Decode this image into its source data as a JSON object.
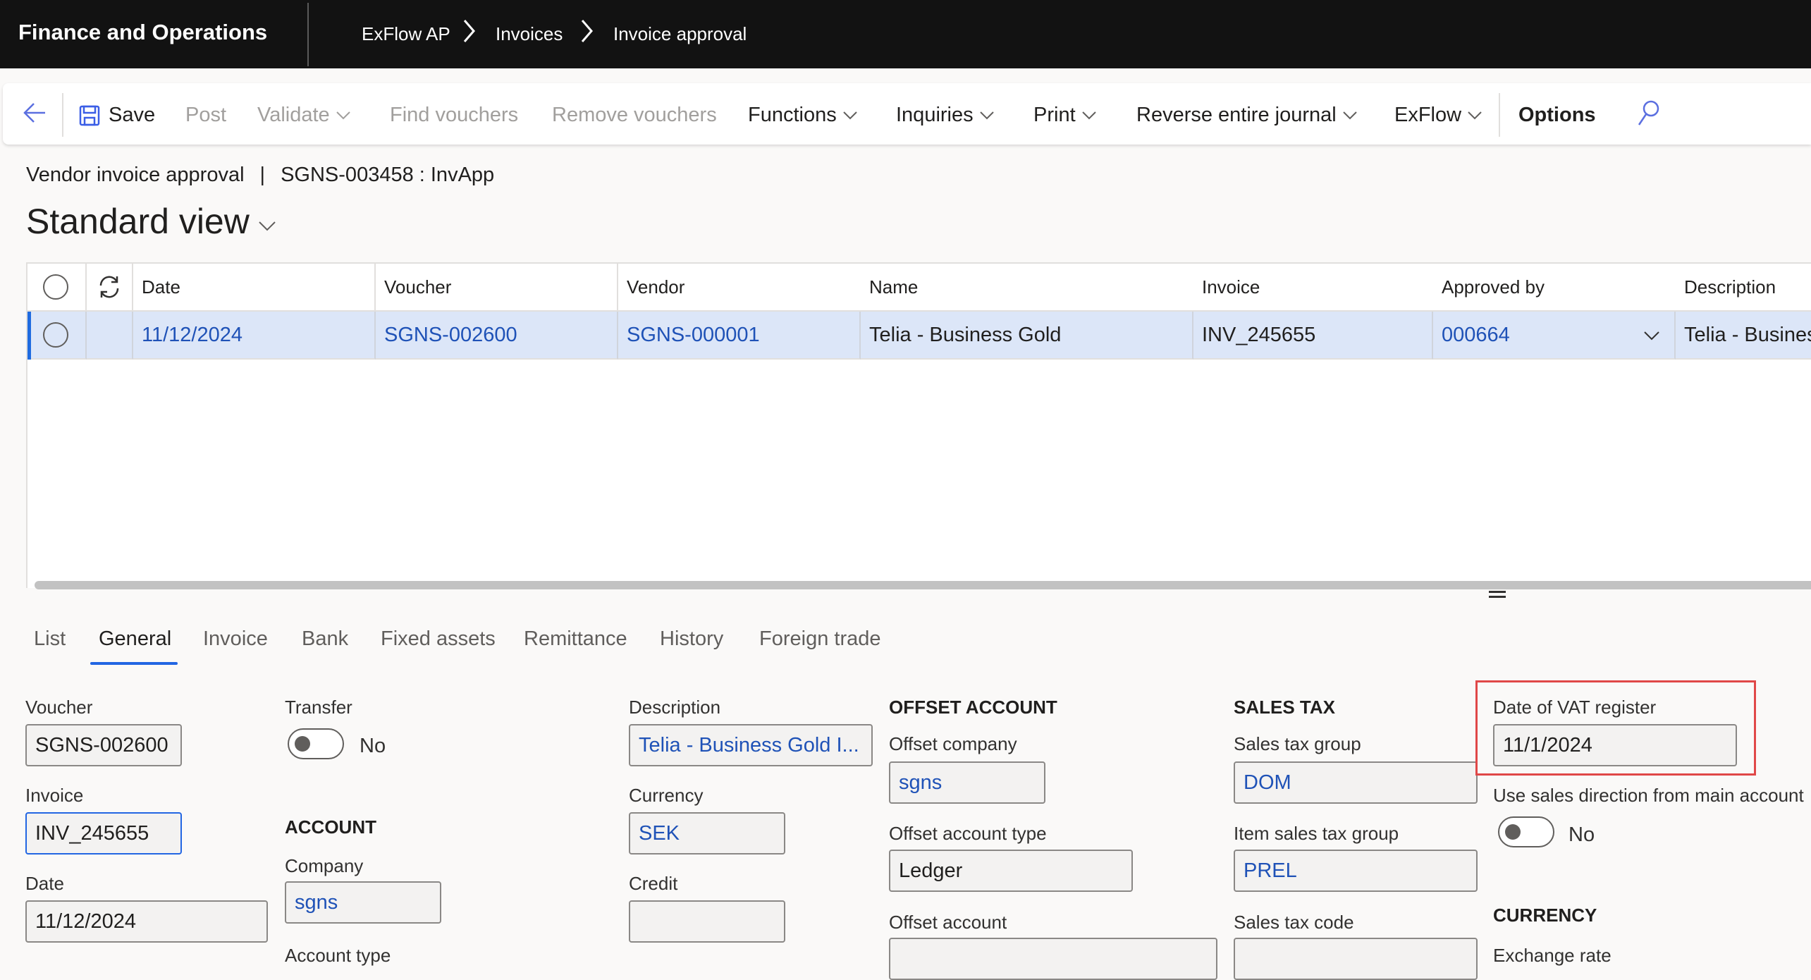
{
  "navbar": {
    "app_title": "Finance and Operations",
    "breadcrumbs": [
      "ExFlow AP",
      "Invoices",
      "Invoice approval"
    ]
  },
  "toolbar": {
    "back_icon": "back-arrow-icon",
    "items": [
      {
        "label": "Save",
        "enabled": true,
        "icon": "save-icon",
        "dropdown": false
      },
      {
        "label": "Post",
        "enabled": false,
        "dropdown": false
      },
      {
        "label": "Validate",
        "enabled": false,
        "dropdown": true
      },
      {
        "label": "Find vouchers",
        "enabled": false,
        "dropdown": false
      },
      {
        "label": "Remove vouchers",
        "enabled": false,
        "dropdown": false
      },
      {
        "label": "Functions",
        "enabled": true,
        "dropdown": true
      },
      {
        "label": "Inquiries",
        "enabled": true,
        "dropdown": true
      },
      {
        "label": "Print",
        "enabled": true,
        "dropdown": true
      },
      {
        "label": "Reverse entire journal",
        "enabled": true,
        "dropdown": true
      },
      {
        "label": "ExFlow",
        "enabled": true,
        "dropdown": true
      },
      {
        "label": "Options",
        "enabled": true,
        "dropdown": false
      }
    ],
    "search_icon": "search-icon"
  },
  "page": {
    "caption_left": "Vendor invoice approval",
    "caption_sep": "|",
    "caption_right": "SGNS-003458 : InvApp",
    "view_title": "Standard view"
  },
  "grid": {
    "columns": [
      "Date",
      "Voucher",
      "Vendor",
      "Name",
      "Invoice",
      "Approved by",
      "Description"
    ],
    "rows": [
      {
        "Date": "11/12/2024",
        "Voucher": "SGNS-002600",
        "Vendor": "SGNS-000001",
        "Name": "Telia - Business Gold",
        "Invoice": "INV_245655",
        "Approved by": "000664",
        "Description": "Telia - Business Gold I..."
      }
    ],
    "selected_row": 0
  },
  "tabs": {
    "items": [
      "List",
      "General",
      "Invoice",
      "Bank",
      "Fixed assets",
      "Remittance",
      "History",
      "Foreign trade"
    ],
    "active": "General"
  },
  "form": {
    "voucher": {
      "label": "Voucher",
      "value": "SGNS-002600"
    },
    "invoice": {
      "label": "Invoice",
      "value": "INV_245655"
    },
    "date": {
      "label": "Date",
      "value": "11/12/2024"
    },
    "transfer": {
      "label": "Transfer",
      "value": "No",
      "on": false
    },
    "account_group": "ACCOUNT",
    "company": {
      "label": "Company",
      "value": "sgns"
    },
    "account_type": {
      "label": "Account type"
    },
    "description": {
      "label": "Description",
      "value": "Telia - Business Gold I..."
    },
    "currency": {
      "label": "Currency",
      "value": "SEK"
    },
    "credit": {
      "label": "Credit",
      "value": ""
    },
    "offset_group": "OFFSET ACCOUNT",
    "offset_company": {
      "label": "Offset company",
      "value": "sgns"
    },
    "offset_account_type": {
      "label": "Offset account type",
      "value": "Ledger"
    },
    "offset_account": {
      "label": "Offset account",
      "value": ""
    },
    "sales_tax_group_heading": "SALES TAX",
    "sales_tax_group": {
      "label": "Sales tax group",
      "value": "DOM"
    },
    "item_sales_tax_group": {
      "label": "Item sales tax group",
      "value": "PREL"
    },
    "sales_tax_code": {
      "label": "Sales tax code",
      "value": ""
    },
    "vat_register_date": {
      "label": "Date of VAT register",
      "value": "11/1/2024"
    },
    "use_sales_direction": {
      "label": "Use sales direction from main account",
      "value": "No",
      "on": false
    },
    "currency_group": "CURRENCY",
    "exchange_rate": {
      "label": "Exchange rate"
    }
  },
  "colors": {
    "accent": "#2266e3",
    "link": "#1f52b7",
    "selected_row": "#dce6f8",
    "highlight_box": "#e04848",
    "navbar": "#121212"
  }
}
